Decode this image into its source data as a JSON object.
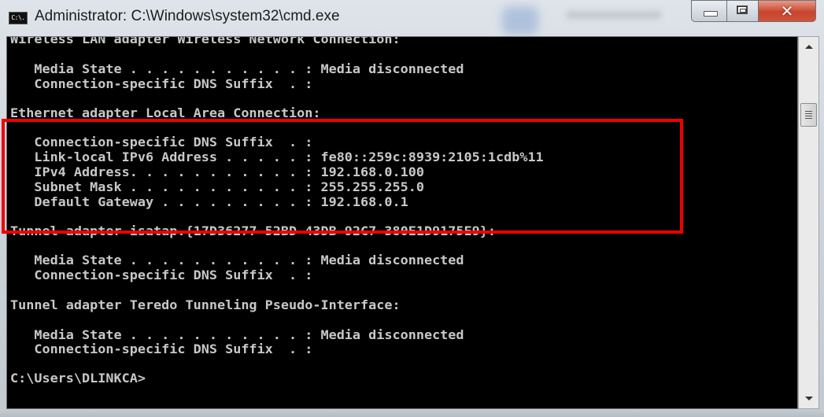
{
  "window": {
    "title": "Administrator: C:\\Windows\\system32\\cmd.exe",
    "icon": "cmd-icon",
    "icon_label": "C:\\.",
    "controls": {
      "minimize": "minimize-icon",
      "maximize": "maximize-icon",
      "close": "close-icon",
      "close_glyph": "✕"
    }
  },
  "console": {
    "lines": [
      "Wireless LAN adapter Wireless Network Connection:",
      "",
      "   Media State . . . . . . . . . . . : Media disconnected",
      "   Connection-specific DNS Suffix  . :",
      "",
      "Ethernet adapter Local Area Connection:",
      "",
      "   Connection-specific DNS Suffix  . :",
      "   Link-local IPv6 Address . . . . . : fe80::259c:8939:2105:1cdb%11",
      "   IPv4 Address. . . . . . . . . . . : 192.168.0.100",
      "   Subnet Mask . . . . . . . . . . . : 255.255.255.0",
      "   Default Gateway . . . . . . . . . : 192.168.0.1",
      "",
      "Tunnel adapter isatap.{17D36277-52BD-43DB-92C7-380E1D9175E9}:",
      "",
      "   Media State . . . . . . . . . . . : Media disconnected",
      "   Connection-specific DNS Suffix  . :",
      "",
      "Tunnel adapter Teredo Tunneling Pseudo-Interface:",
      "",
      "   Media State . . . . . . . . . . . : Media disconnected",
      "   Connection-specific DNS Suffix  . :",
      "",
      "C:\\Users\\DLINKCA>"
    ],
    "prompt": "C:\\Users\\DLINKCA>",
    "text_color": "#c8c8c8",
    "background_color": "#000000"
  },
  "annotation": {
    "highlight_color": "#ee0000",
    "highlighted_section": "Ethernet adapter Local Area Connection"
  },
  "scrollbar": {
    "up_icon": "scroll-up-arrow-icon",
    "down_icon": "scroll-down-arrow-icon"
  }
}
